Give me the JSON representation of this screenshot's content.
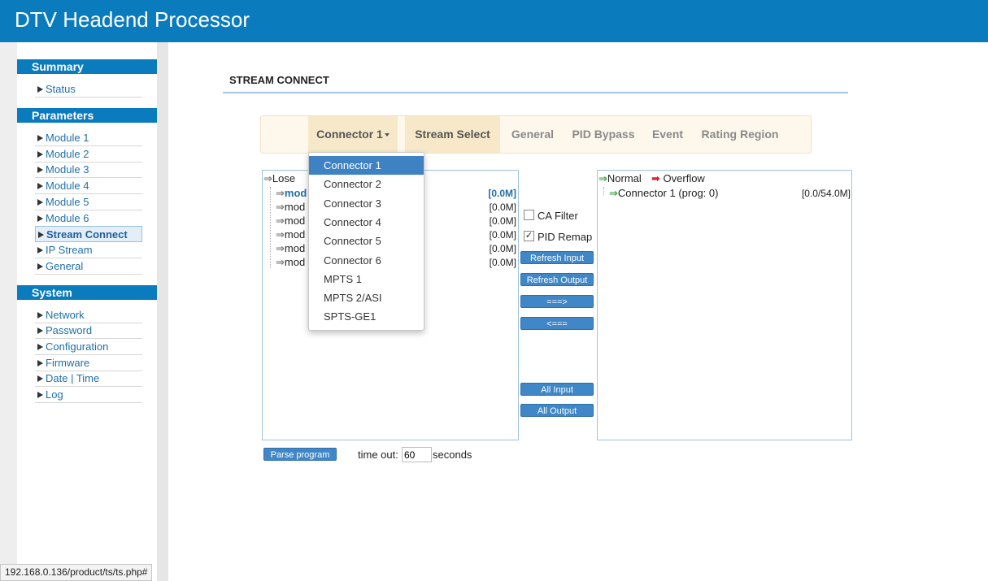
{
  "app": {
    "title": "DTV Headend Processor"
  },
  "sidebar": {
    "summary": {
      "heading": "Summary",
      "items": [
        "Status"
      ]
    },
    "parameters": {
      "heading": "Parameters",
      "items": [
        "Module 1",
        "Module 2",
        "Module 3",
        "Module 4",
        "Module 5",
        "Module 6",
        "Stream Connect",
        "IP Stream",
        "General"
      ]
    },
    "system": {
      "heading": "System",
      "items": [
        "Network",
        "Password",
        "Configuration",
        "Firmware",
        "Date | Time",
        "Log"
      ]
    }
  },
  "page": {
    "title": "STREAM CONNECT"
  },
  "tabs": {
    "connector": "Connector 1",
    "items": [
      "Stream Select",
      "General",
      "PID Bypass",
      "Event",
      "Rating Region"
    ]
  },
  "dropdown": {
    "options": [
      "Connector 1",
      "Connector 2",
      "Connector 3",
      "Connector 4",
      "Connector 5",
      "Connector 6",
      "MPTS 1",
      "MPTS 2/ASI",
      "SPTS-GE1"
    ],
    "selected": "Connector 1"
  },
  "input_panel": {
    "legend_lose": "Lose",
    "rows": [
      {
        "label": "mod",
        "rate": "[0.0M]"
      },
      {
        "label": "mod",
        "rate": "[0.0M]"
      },
      {
        "label": "mod",
        "rate": "[0.0M]"
      },
      {
        "label": "mod",
        "rate": "[0.0M]"
      },
      {
        "label": "mod",
        "rate": "[0.0M]"
      },
      {
        "label": "mod",
        "rate": "[0.0M]"
      }
    ]
  },
  "controls": {
    "ca_filter": "CA Filter",
    "ca_filter_checked": false,
    "pid_remap": "PID Remap",
    "pid_remap_checked": true,
    "refresh_input": "Refresh Input",
    "refresh_output": "Refresh Output",
    "move_right": "===>",
    "move_left": "<===",
    "all_input": "All Input",
    "all_output": "All Output"
  },
  "output_panel": {
    "legend_normal": "Normal",
    "legend_overflow": "Overflow",
    "row_label": "Connector 1 (prog: 0)",
    "row_rate": "[0.0/54.0M]"
  },
  "bottom": {
    "parse_button": "Parse program",
    "timeout_label": "time out:",
    "timeout_value": "60",
    "timeout_unit": "seconds"
  },
  "status_url": "192.168.0.136/product/ts/ts.php#",
  "colors": {
    "header": "#0a7bbd",
    "button": "#3f87c6",
    "tab_bg": "#fdf7ec"
  }
}
